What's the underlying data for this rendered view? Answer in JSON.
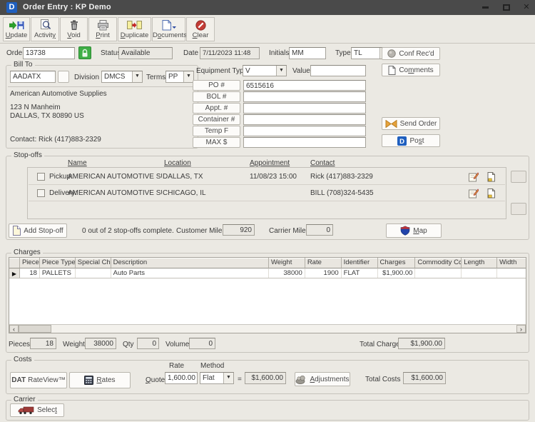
{
  "colors": {
    "titlebar": "#4a4a4a",
    "brand_blue": "#1f5fbf",
    "window_bg": "#ebe9e3",
    "lock_green": "#3fae46",
    "clear_red": "#c43c35",
    "send_orange": "#e7a33c"
  },
  "window": {
    "logo_letter": "D",
    "title": "Order Entry :  KP Demo"
  },
  "toolbar": {
    "update": "Update",
    "activity": "Activity",
    "void": "Void",
    "print": "Print",
    "duplicate": "Duplicate",
    "documents": "Documents",
    "clear": "Clear"
  },
  "order": {
    "order_label": "Order",
    "order_number": "13738",
    "status_label": "Status",
    "status_value": "Available",
    "date_label": "Date",
    "date_value": "7/11/2023 11:48",
    "initials_label": "Initials",
    "initials_value": "MM",
    "type_label": "Type",
    "type_value": "TL"
  },
  "actions": {
    "conf_recd": "Conf Rec'd",
    "comments": "Comments",
    "send_order": "Send Order",
    "post": "Post"
  },
  "bill_to": {
    "group_label": "Bill To",
    "code": "AADATX",
    "division_label": "Division",
    "division_value": "DMCS",
    "terms_label": "Terms",
    "terms_value": "PP",
    "company": "American Automotive Supplies",
    "address_line1": "123 N Manheim",
    "address_line2": "DALLAS, TX  80890  US",
    "contact_line": "Contact: Rick  (417)883-2329"
  },
  "shipment": {
    "equipment_type_label": "Equipment Type",
    "equipment_type_value": "V",
    "value_label": "Value",
    "value_value": "",
    "refs": [
      {
        "label": "PO #",
        "value": "6515616"
      },
      {
        "label": "BOL #",
        "value": ""
      },
      {
        "label": "Appt. #",
        "value": ""
      },
      {
        "label": "Container #",
        "value": ""
      },
      {
        "label": "Temp F",
        "value": ""
      },
      {
        "label": "MAX $",
        "value": ""
      }
    ]
  },
  "stop_offs": {
    "group_label": "Stop-offs",
    "col_name": "Name",
    "col_location": "Location",
    "col_appointment": "Appointment",
    "col_contact": "Contact",
    "rows": [
      {
        "type_label": "Pickup:",
        "name": "AMERICAN AUTOMOTIVE SUPPLIES",
        "location": "DALLAS, TX",
        "appointment": "11/08/23 15:00",
        "contact": "Rick  (417)883-2329"
      },
      {
        "type_label": "Delivery:",
        "name": "AMERICAN AUTOMOTIVE SUPPLIES",
        "location": "CHICAGO, IL",
        "appointment": "",
        "contact": "BILL  (708)324-5435"
      }
    ],
    "add_button": "Add Stop-off",
    "progress_text": "0 out of 2 stop-offs complete.",
    "customer_miles_label": "Customer Miles:",
    "customer_miles_value": "920",
    "carrier_miles_label": "Carrier Miles",
    "carrier_miles_value": "0",
    "map_button": "Map"
  },
  "charges": {
    "group_label": "Charges",
    "columns": [
      "Pieces",
      "Piece Type",
      "Special Chg",
      "Description",
      "Weight",
      "Rate",
      "Identifier",
      "Charges",
      "Commodity Code",
      "Length",
      "Width"
    ],
    "rows": [
      [
        "18",
        "PALLETS",
        "",
        "Auto Parts",
        "38000",
        "1900",
        "FLAT",
        "$1,900.00",
        "",
        "",
        ""
      ]
    ],
    "pieces_label": "Pieces",
    "pieces_value": "18",
    "weight_label": "Weight",
    "weight_value": "38000",
    "qty_label": "Qty",
    "qty_value": "0",
    "volume_label": "Volume",
    "volume_value": "0",
    "total_charges_label": "Total Charges",
    "total_charges_value": "$1,900.00"
  },
  "costs": {
    "group_label": "Costs",
    "dat_brand": "DAT",
    "dat_product": "RateView™",
    "rates_button": "Rates",
    "quote_label": "Quote",
    "rate_label": "Rate",
    "rate_value": "1,600.00",
    "method_label": "Method",
    "method_value": "Flat",
    "equals": "=",
    "quote_total_value": "$1,600.00",
    "adjustments_button": "Adjustments",
    "total_costs_label": "Total Costs",
    "total_costs_value": "$1,600.00"
  },
  "carrier": {
    "group_label": "Carrier",
    "select_button": "Select"
  }
}
